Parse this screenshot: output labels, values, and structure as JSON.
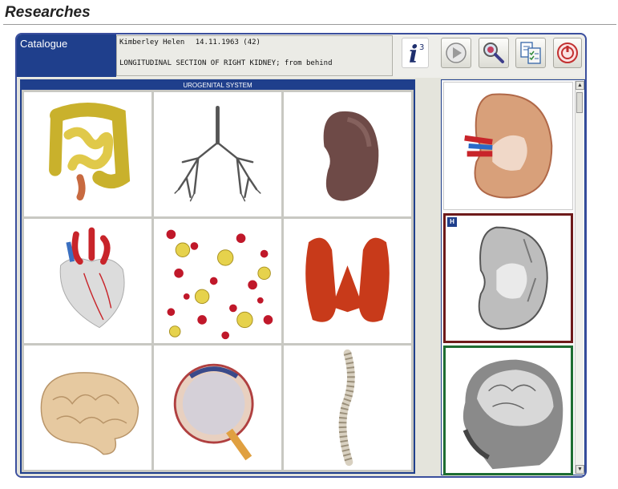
{
  "page": {
    "title": "Researches"
  },
  "header": {
    "tab_label": "Catalogue",
    "patient_name": "Kimberley  Helen",
    "patient_dob": "14.11.1963 (42)",
    "study_description": "LONGITUDINAL SECTION OF RIGHT KIDNEY; from behind",
    "info_button_glyph": "i",
    "info_button_superscript": "3"
  },
  "toolbar": {
    "buttons": [
      {
        "icon": "play-icon"
      },
      {
        "icon": "zoom-search-icon"
      },
      {
        "icon": "document-checklist-icon"
      },
      {
        "icon": "power-icon"
      }
    ]
  },
  "grid": {
    "section_title": "UROGENITAL SYSTEM",
    "items": [
      {
        "icon": "intestine-image"
      },
      {
        "icon": "bronchial-tree-image"
      },
      {
        "icon": "kidney-image"
      },
      {
        "icon": "heart-image"
      },
      {
        "icon": "blood-cells-image"
      },
      {
        "icon": "thyroid-image"
      },
      {
        "icon": "brain-image"
      },
      {
        "icon": "eye-section-image"
      },
      {
        "icon": "spine-image"
      }
    ]
  },
  "previews": {
    "badge": "H",
    "items": [
      {
        "icon": "kidney-section-color-image",
        "state": "normal"
      },
      {
        "icon": "kidney-section-grayscale-image",
        "state": "highlighted",
        "border_color": "#6e1a1a"
      },
      {
        "icon": "head-mri-image",
        "state": "selected",
        "border_color": "#1e6d32"
      }
    ]
  },
  "colors": {
    "accent": "#1f3f8c",
    "frame": "#3b4f9e"
  }
}
